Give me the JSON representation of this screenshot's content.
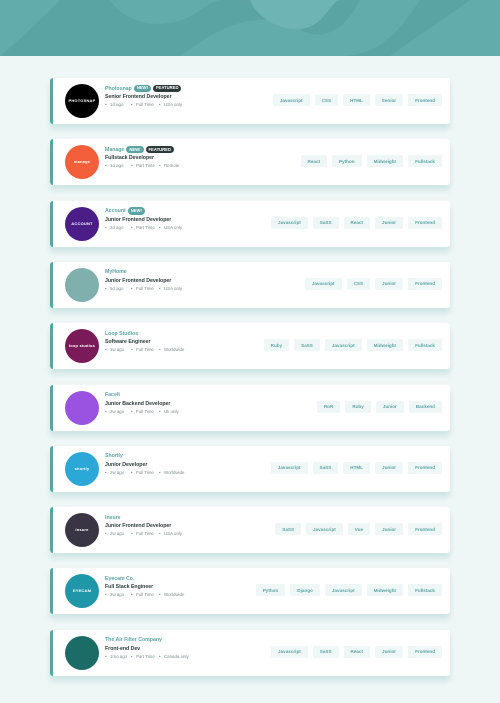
{
  "colors": {
    "accent": "#5ba4a4",
    "dark": "#2c3a3a",
    "background": "#eff6f6"
  },
  "jobs": [
    {
      "company": "Photosnap",
      "new": "NEW!",
      "featured": "FEATURED",
      "position": "Senior Frontend Developer",
      "posted": "1d ago",
      "contract": "Full Time",
      "location": "USA only",
      "logo": {
        "text": "PHOTOSNAP",
        "color": "#000000"
      },
      "tags": [
        "Javascript",
        "CSS",
        "HTML",
        "Senior",
        "Frontend"
      ]
    },
    {
      "company": "Manage",
      "new": "NEW!",
      "featured": "FEATURED",
      "position": "Fullstack Developer",
      "posted": "1d ago",
      "contract": "Part Time",
      "location": "Remote",
      "logo": {
        "text": "manage",
        "color": "#f25f3a"
      },
      "tags": [
        "React",
        "Python",
        "Midweight",
        "Fullstack"
      ]
    },
    {
      "company": "Account",
      "new": "NEW!",
      "featured": "",
      "position": "Junior Frontend Developer",
      "posted": "2d ago",
      "contract": "Part Time",
      "location": "USA only",
      "logo": {
        "text": "ACCOUNT",
        "color": "#4a1d87"
      },
      "tags": [
        "Javascript",
        "SaSS",
        "React",
        "Junior",
        "Frontend"
      ]
    },
    {
      "company": "MyHome",
      "new": "",
      "featured": "",
      "position": "Junior Frontend Developer",
      "posted": "5d ago",
      "contract": "Full Time",
      "location": "USA only",
      "logo": {
        "text": "",
        "color": "#7fb0ae"
      },
      "tags": [
        "Javascript",
        "CSS",
        "Junior",
        "Frontend"
      ]
    },
    {
      "company": "Loop Studios",
      "new": "",
      "featured": "",
      "position": "Software Engineer",
      "posted": "1w ago",
      "contract": "Full Time",
      "location": "Worldwide",
      "logo": {
        "text": "loop studios",
        "color": "#7a1a58"
      },
      "tags": [
        "Ruby",
        "SaSS",
        "Javascript",
        "Midweight",
        "Fullstack"
      ]
    },
    {
      "company": "FaceIt",
      "new": "",
      "featured": "",
      "position": "Junior Backend Developer",
      "posted": "2w ago",
      "contract": "Full Time",
      "location": "Uk only",
      "logo": {
        "text": "",
        "color": "#9a52e0"
      },
      "tags": [
        "RoR",
        "Ruby",
        "Junior",
        "Backend"
      ]
    },
    {
      "company": "Shortly",
      "new": "",
      "featured": "",
      "position": "Junior Developer",
      "posted": "2w ago",
      "contract": "Full Time",
      "location": "Worldwide",
      "logo": {
        "text": "shortly",
        "color": "#2ba7d8"
      },
      "tags": [
        "Javascript",
        "SaSS",
        "HTML",
        "Junior",
        "Frontend"
      ]
    },
    {
      "company": "Insure",
      "new": "",
      "featured": "",
      "position": "Junior Frontend Developer",
      "posted": "2w ago",
      "contract": "Full Time",
      "location": "USA only",
      "logo": {
        "text": "insure",
        "color": "#3a3545"
      },
      "tags": [
        "SaSS",
        "Javascript",
        "Vue",
        "Junior",
        "Frontend"
      ]
    },
    {
      "company": "Eyecam Co.",
      "new": "",
      "featured": "",
      "position": "Full Stack Engineer",
      "posted": "3w ago",
      "contract": "Full Time",
      "location": "Worldwide",
      "logo": {
        "text": "EYECAM",
        "color": "#1f97a8"
      },
      "tags": [
        "Python",
        "Django",
        "Javascript",
        "Midweight",
        "Fullstack"
      ]
    },
    {
      "company": "The Air Filter Company",
      "new": "",
      "featured": "",
      "position": "Front-end Dev",
      "posted": "1mo ago",
      "contract": "Part Time",
      "location": "Canada only",
      "logo": {
        "text": "",
        "color": "#1b6b66"
      },
      "tags": [
        "Javascript",
        "SaSS",
        "React",
        "Junior",
        "Frontend"
      ]
    }
  ]
}
